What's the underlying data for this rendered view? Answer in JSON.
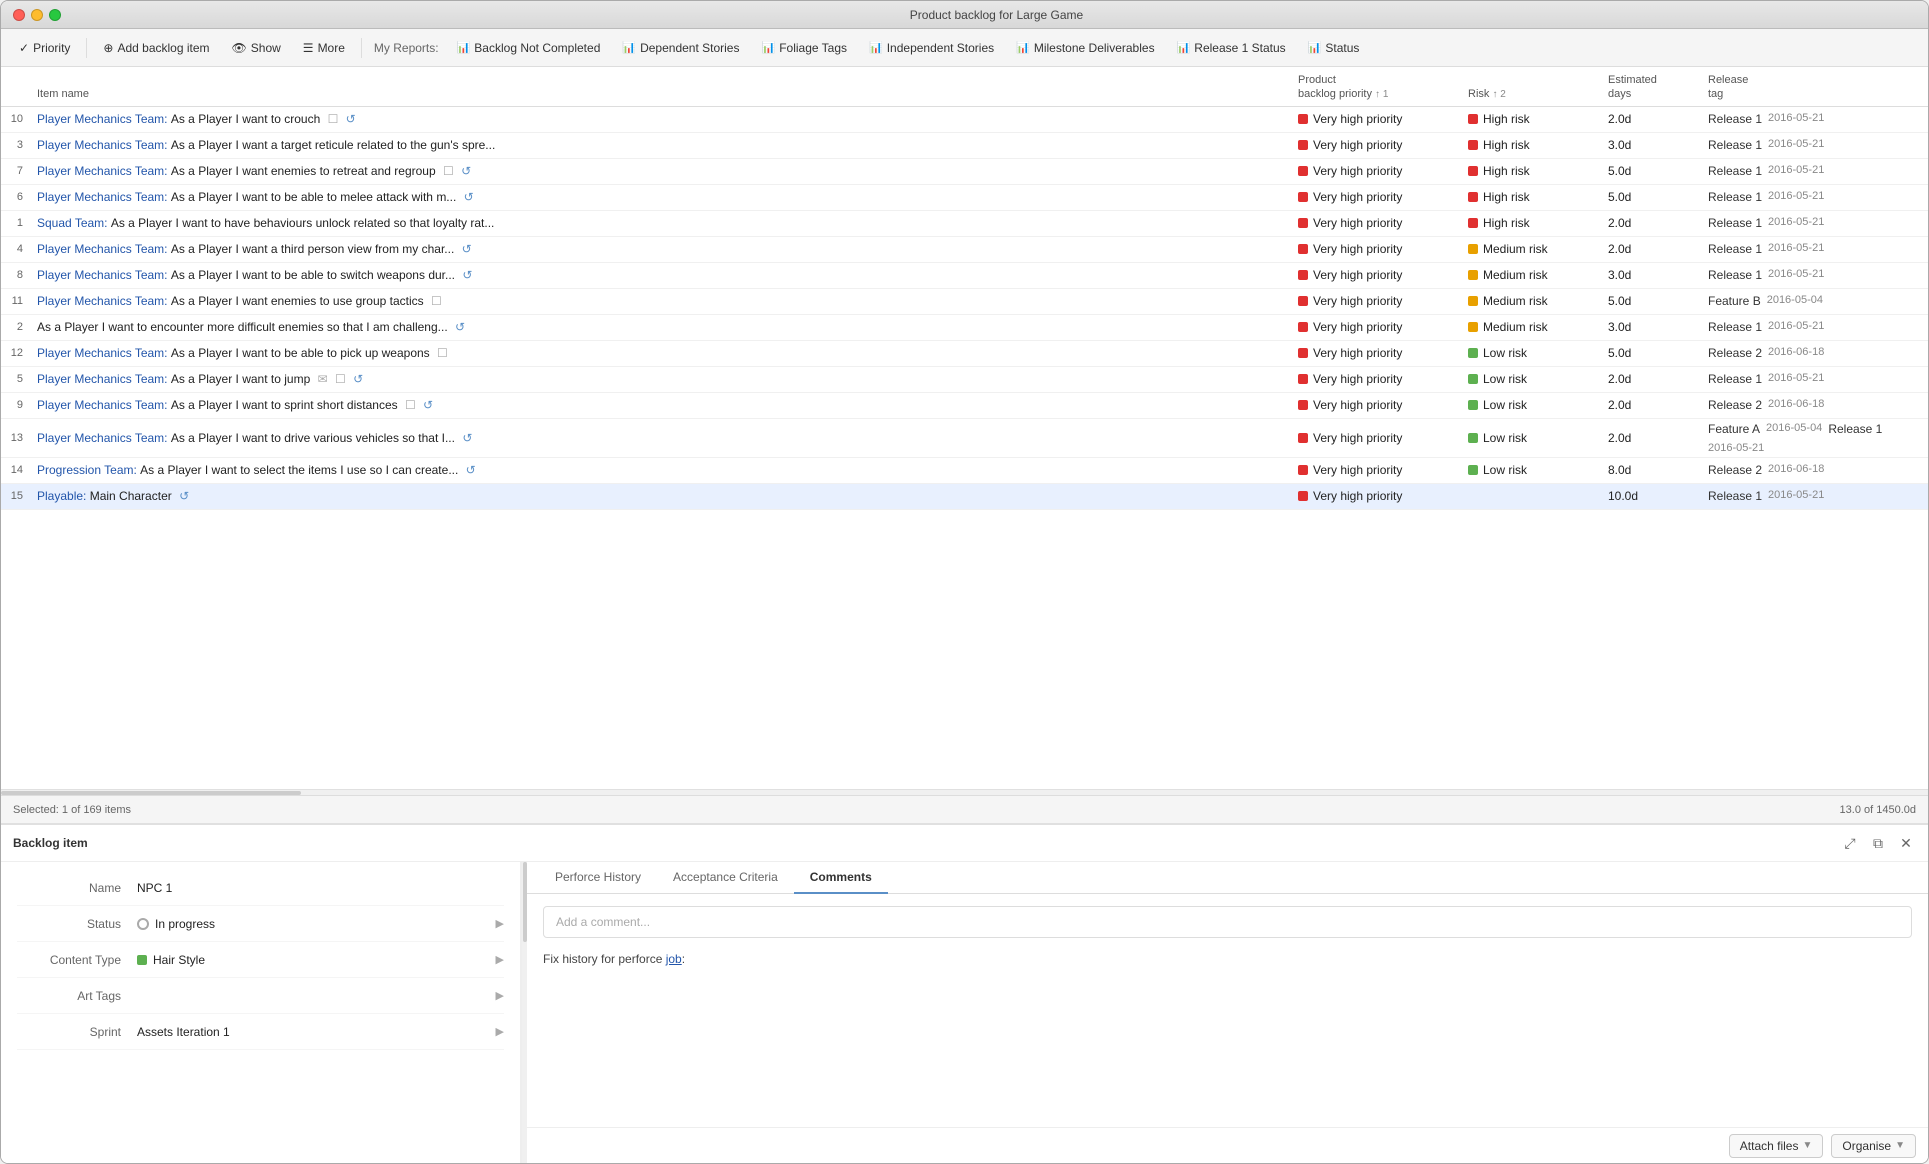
{
  "window": {
    "title": "Product backlog for Large Game"
  },
  "toolbar": {
    "priority_label": "Priority",
    "add_backlog_label": "Add backlog item",
    "show_label": "Show",
    "more_label": "More",
    "reports_label": "My Reports:",
    "report_items": [
      "Backlog Not Completed",
      "Dependent Stories",
      "Foliage Tags",
      "Independent Stories",
      "Milestone Deliverables",
      "Release 1 Status",
      "Status"
    ]
  },
  "table": {
    "columns": {
      "item_name": "Item name",
      "priority": "Product\nbacklog priority",
      "priority_sort": "↑ 1",
      "risk": "Risk",
      "risk_sort": "↑ 2",
      "estimated_days": "Estimated\ndays",
      "release_tag": "Release\ntag"
    },
    "rows": [
      {
        "num": "10",
        "name": "Player Mechanics Team: As a Player I want to crouch",
        "team": "Player Mechanics Team",
        "task": "As a Player I want to crouch",
        "has_checkbox": true,
        "has_cycle": true,
        "priority": "Very high priority",
        "priority_color": "red",
        "risk": "High risk",
        "risk_color": "red",
        "est": "2.0d",
        "release_tag": "Release 1",
        "release_date": "2016-05-21",
        "selected": false
      },
      {
        "num": "3",
        "name": "Player Mechanics Team: As a Player I want a target reticule related to the gun's spre...",
        "team": "Player Mechanics Team",
        "task": "As a Player I want a target reticule related to the gun's spre...",
        "has_checkbox": false,
        "has_cycle": false,
        "priority": "Very high priority",
        "priority_color": "red",
        "risk": "High risk",
        "risk_color": "red",
        "est": "3.0d",
        "release_tag": "Release 1",
        "release_date": "2016-05-21",
        "selected": false
      },
      {
        "num": "7",
        "name": "Player Mechanics Team: As a Player I want enemies to retreat and regroup",
        "team": "Player Mechanics Team",
        "task": "As a Player I want enemies to retreat and regroup",
        "has_checkbox": true,
        "has_cycle": true,
        "priority": "Very high priority",
        "priority_color": "red",
        "risk": "High risk",
        "risk_color": "red",
        "est": "5.0d",
        "release_tag": "Release 1",
        "release_date": "2016-05-21",
        "selected": false
      },
      {
        "num": "6",
        "name": "Player Mechanics Team: As a Player I want to be able to melee attack with m...",
        "team": "Player Mechanics Team",
        "task": "As a Player I want to be able to melee attack with m...",
        "has_checkbox": false,
        "has_cycle": true,
        "priority": "Very high priority",
        "priority_color": "red",
        "risk": "High risk",
        "risk_color": "red",
        "est": "5.0d",
        "release_tag": "Release 1",
        "release_date": "2016-05-21",
        "selected": false
      },
      {
        "num": "1",
        "name": "Squad Team: As a Player I want to have behaviours unlock related so that loyalty rat...",
        "team": "Squad Team",
        "task": "As a Player I want to have behaviours unlock related so that loyalty rat...",
        "has_checkbox": false,
        "has_cycle": false,
        "priority": "Very high priority",
        "priority_color": "red",
        "risk": "High risk",
        "risk_color": "red",
        "est": "2.0d",
        "release_tag": "Release 1",
        "release_date": "2016-05-21",
        "selected": false
      },
      {
        "num": "4",
        "name": "Player Mechanics Team: As a Player I want a third person view from my char...",
        "team": "Player Mechanics Team",
        "task": "As a Player I want a third person view from my char...",
        "has_checkbox": false,
        "has_cycle": true,
        "priority": "Very high priority",
        "priority_color": "red",
        "risk": "Medium risk",
        "risk_color": "yellow",
        "est": "2.0d",
        "release_tag": "Release 1",
        "release_date": "2016-05-21",
        "selected": false
      },
      {
        "num": "8",
        "name": "Player Mechanics Team: As a Player I want to be able to switch weapons dur...",
        "team": "Player Mechanics Team",
        "task": "As a Player I want to be able to switch weapons dur...",
        "has_checkbox": false,
        "has_cycle": true,
        "priority": "Very high priority",
        "priority_color": "red",
        "risk": "Medium risk",
        "risk_color": "yellow",
        "est": "3.0d",
        "release_tag": "Release 1",
        "release_date": "2016-05-21",
        "selected": false
      },
      {
        "num": "11",
        "name": "Player Mechanics Team: As a Player I want enemies to use group tactics",
        "team": "Player Mechanics Team",
        "task": "As a Player I want enemies to use group tactics",
        "has_checkbox": true,
        "has_cycle": false,
        "priority": "Very high priority",
        "priority_color": "red",
        "risk": "Medium risk",
        "risk_color": "yellow",
        "est": "5.0d",
        "release_tag": "Feature B",
        "release_date": "2016-05-04",
        "selected": false
      },
      {
        "num": "2",
        "name": "As a Player I want to encounter more difficult enemies so that I am challeng...",
        "team": "",
        "task": "As a Player I want to encounter more difficult enemies so that I am challeng...",
        "has_checkbox": false,
        "has_cycle": true,
        "priority": "Very high priority",
        "priority_color": "red",
        "risk": "Medium risk",
        "risk_color": "yellow",
        "est": "3.0d",
        "release_tag": "Release 1",
        "release_date": "2016-05-21",
        "selected": false
      },
      {
        "num": "12",
        "name": "Player Mechanics Team: As a Player I want to be able to pick up weapons",
        "team": "Player Mechanics Team",
        "task": "As a Player I want to be able to pick up weapons",
        "has_checkbox": true,
        "has_cycle": false,
        "priority": "Very high priority",
        "priority_color": "red",
        "risk": "Low risk",
        "risk_color": "green",
        "est": "5.0d",
        "release_tag": "Release 2",
        "release_date": "2016-06-18",
        "selected": false
      },
      {
        "num": "5",
        "name": "Player Mechanics Team: As a Player I want to jump",
        "team": "Player Mechanics Team",
        "task": "As a Player I want to jump",
        "has_checkbox": true,
        "has_cycle": true,
        "has_email": true,
        "priority": "Very high priority",
        "priority_color": "red",
        "risk": "Low risk",
        "risk_color": "green",
        "est": "2.0d",
        "release_tag": "Release 1",
        "release_date": "2016-05-21",
        "selected": false
      },
      {
        "num": "9",
        "name": "Player Mechanics Team: As a Player I want to sprint short distances",
        "team": "Player Mechanics Team",
        "task": "As a Player I want to sprint short distances",
        "has_checkbox": true,
        "has_cycle": true,
        "priority": "Very high priority",
        "priority_color": "red",
        "risk": "Low risk",
        "risk_color": "green",
        "est": "2.0d",
        "release_tag": "Release 2",
        "release_date": "2016-06-18",
        "selected": false
      },
      {
        "num": "13",
        "name": "Player Mechanics Team: As a Player I want to drive various vehicles so that I...",
        "team": "Player Mechanics Team",
        "task": "As a Player I want to drive various vehicles so that I...",
        "has_checkbox": false,
        "has_cycle": true,
        "priority": "Very high priority",
        "priority_color": "red",
        "risk": "Low risk",
        "risk_color": "green",
        "est": "2.0d",
        "release_tag": "Feature A",
        "release_date": "2016-05-04",
        "release_tag2": "Release 1",
        "release_date2": "2016-05-21",
        "selected": false
      },
      {
        "num": "14",
        "name": "Progression Team: As a Player I want to select the items I use so I can create...",
        "team": "Progression Team",
        "task": "As a Player I want to select the items I use so I can create...",
        "has_checkbox": false,
        "has_cycle": true,
        "priority": "Very high priority",
        "priority_color": "red",
        "risk": "Low risk",
        "risk_color": "green",
        "est": "8.0d",
        "release_tag": "Release 2",
        "release_date": "2016-06-18",
        "selected": false
      },
      {
        "num": "15",
        "name": "Playable: Main Character",
        "team": "Playable",
        "task": "Main Character",
        "has_checkbox": false,
        "has_cycle": true,
        "priority": "Very high priority",
        "priority_color": "red",
        "risk": "",
        "risk_color": "",
        "est": "10.0d",
        "release_tag": "Release 1",
        "release_date": "2016-05-21",
        "selected": true
      }
    ]
  },
  "status_bar": {
    "selected_text": "Selected: 1 of 169 items",
    "total_text": "13.0 of 1450.0d"
  },
  "detail_panel": {
    "title": "Backlog item",
    "form": {
      "name_label": "Name",
      "name_value": "NPC 1",
      "status_label": "Status",
      "status_value": "In progress",
      "content_type_label": "Content Type",
      "content_type_value": "Hair Style",
      "content_type_color": "green",
      "art_tags_label": "Art Tags",
      "sprint_label": "Sprint",
      "sprint_value": "Assets Iteration 1"
    },
    "tabs": [
      "Perforce History",
      "Acceptance Criteria",
      "Comments"
    ],
    "active_tab": "Comments",
    "comment_placeholder": "Add a comment...",
    "history_text": "Fix history for perforce ",
    "history_link": "job",
    "history_suffix": ":",
    "footer": {
      "attach_label": "Attach files",
      "organise_label": "Organise"
    }
  }
}
